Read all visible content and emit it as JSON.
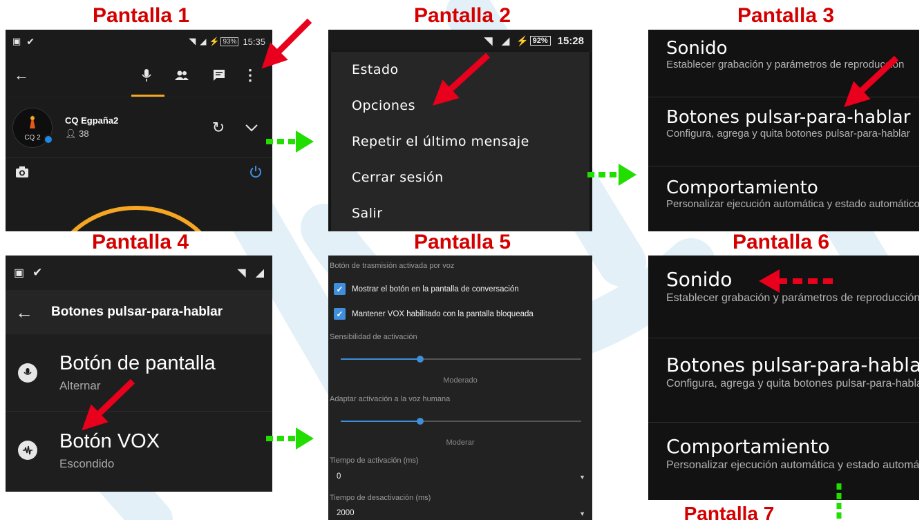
{
  "titles": [
    "Pantalla 1",
    "Pantalla 2",
    "Pantalla 3",
    "Pantalla 4",
    "Pantalla 5",
    "Pantalla 6",
    "Pantalla 7"
  ],
  "screen1": {
    "battery": "93%",
    "time": "15:35",
    "channel_name": "CQ Egpaña2",
    "user_count": "38",
    "avatar_text": "CQ 2"
  },
  "screen2": {
    "battery": "92%",
    "time": "15:28",
    "menu": [
      "Estado",
      "Opciones",
      "Repetir el último mensaje",
      "Cerrar sesión",
      "Salir"
    ]
  },
  "screen3": {
    "items": [
      {
        "title": "Sonido",
        "subtitle": "Establecer grabación y parámetros de reproducción"
      },
      {
        "title": "Botones pulsar-para-hablar",
        "subtitle": "Configura, agrega y quita botones pulsar-para-hablar"
      },
      {
        "title": "Comportamiento",
        "subtitle": "Personalizar ejecución automática y estado automáticos"
      }
    ]
  },
  "screen4": {
    "toolbar_title": "Botones pulsar-para-hablar",
    "items": [
      {
        "title": "Botón de pantalla",
        "subtitle": "Alternar"
      },
      {
        "title": "Botón VOX",
        "subtitle": "Escondido"
      }
    ]
  },
  "screen5": {
    "header": "Botón de trasmisión activada por voz",
    "checkboxes": [
      {
        "label": "Mostrar el botón en la pantalla de conversación",
        "checked": true
      },
      {
        "label": "Mantener VOX habilitado con la pantalla bloqueada",
        "checked": true
      }
    ],
    "sliders": [
      {
        "label": "Sensibilidad de activación",
        "caption": "Moderado",
        "level": 0.33
      },
      {
        "label": "Adaptar activación a la voz humana",
        "caption": "Moderar",
        "level": 0.33
      }
    ],
    "dropdowns": [
      {
        "label": "Tiempo de activación (ms)",
        "value": "0"
      },
      {
        "label": "Tiempo de desactivación (ms)",
        "value": "2000"
      }
    ]
  },
  "screen6": {
    "items": [
      {
        "title": "Sonido",
        "subtitle": "Establecer grabación y parámetros de reproducción"
      },
      {
        "title": "Botones pulsar-para-hablar",
        "subtitle": "Configura, agrega y quita botones pulsar-para-hablar"
      },
      {
        "title": "Comportamiento",
        "subtitle": "Personalizar ejecución automática y estado automáticos"
      }
    ]
  },
  "colors": {
    "title_red": "#d40000",
    "arrow_red": "#e8001c",
    "arrow_green": "#22dd00",
    "accent_blue": "#3f8fdc",
    "tab_orange": "#f5a623"
  }
}
